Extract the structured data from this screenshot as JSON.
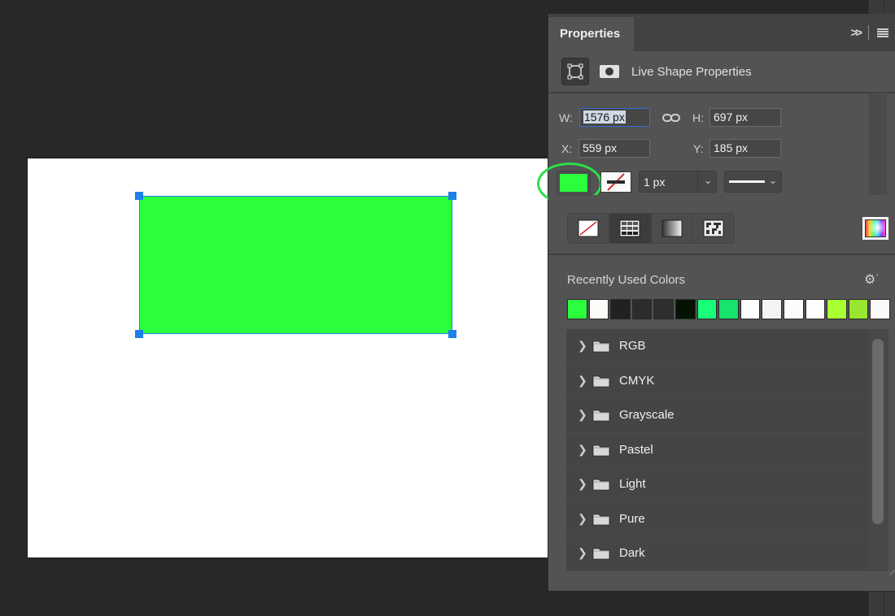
{
  "canvas": {
    "shape_fill": "#2bff3d",
    "selection_color": "#1e7fe8"
  },
  "panel": {
    "title": "Properties",
    "section_title": "Live Shape Properties",
    "w_label": "W:",
    "w_value": "1576 px",
    "h_label": "H:",
    "h_value": "697 px",
    "x_label": "X:",
    "x_value": "559 px",
    "y_label": "Y:",
    "y_value": "185 px",
    "fill_color": "#2bff3d",
    "stroke_width": "1 px",
    "highlight_color": "#2be04a"
  },
  "picker": {
    "type_buttons": [
      "No Color",
      "Solid Color",
      "Gradient",
      "Pattern"
    ],
    "active_type": "Solid Color",
    "recent_title": "Recently Used Colors",
    "recent_colors": [
      "#2bff3d",
      "#fcfdf9",
      "#212121",
      "#2c2c2c",
      "#2e2e2e",
      "#051305",
      "#1aff78",
      "#17e36d",
      "#ffffff",
      "#f3f3f3",
      "#fafdfa",
      "#fcfdfc",
      "#aaff33",
      "#99e62e",
      "#fafafa"
    ],
    "folders": [
      "RGB",
      "CMYK",
      "Grayscale",
      "Pastel",
      "Light",
      "Pure",
      "Dark"
    ]
  }
}
